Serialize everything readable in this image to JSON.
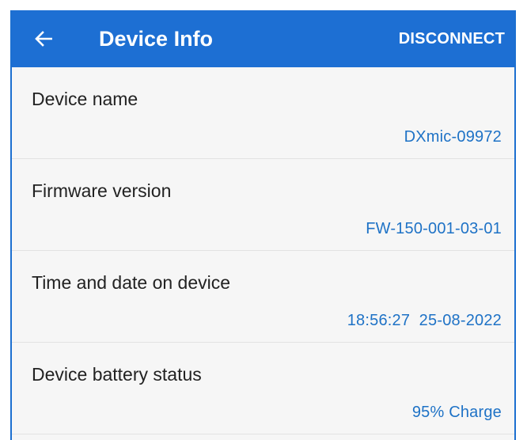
{
  "app_bar": {
    "title": "Device Info",
    "action_label": "DISCONNECT",
    "back_icon": "arrow-left-icon",
    "color": "#1d6fd3"
  },
  "rows": [
    {
      "label": "Device name",
      "value": "DXmic-09972"
    },
    {
      "label": "Firmware version",
      "value": "FW-150-001-03-01"
    },
    {
      "label": "Time and date on device",
      "value": "18:56:27  25-08-2022"
    },
    {
      "label": "Device battery status",
      "value": "95% Charge"
    }
  ],
  "colors": {
    "accent": "#1d6fd3",
    "value_text": "#1e72c6",
    "label_text": "#222222",
    "background": "#f6f6f6"
  }
}
